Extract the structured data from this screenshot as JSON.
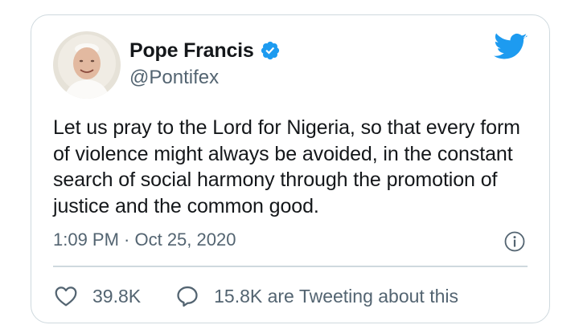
{
  "tweet": {
    "author": {
      "display_name": "Pope Francis",
      "handle": "@Pontifex",
      "verified": true,
      "avatar_icon": "avatar-portrait"
    },
    "text": "Let us pray to the Lord for Nigeria, so that every form of violence might always be avoided, in the constant search of social harmony through the promotion of justice and the common good.",
    "timestamp": "1:09 PM · Oct 25, 2020",
    "likes": "39.8K",
    "replies": "15.8K are Tweeting about this"
  },
  "icons": {
    "brand": "twitter-bird-icon",
    "verified": "verified-badge-icon",
    "info": "info-icon",
    "like": "heart-icon",
    "reply": "speech-bubble-icon"
  },
  "colors": {
    "brand_blue": "#1d9bf0",
    "text_primary": "#14171a",
    "text_secondary": "#536471",
    "border": "#cfd9de"
  }
}
